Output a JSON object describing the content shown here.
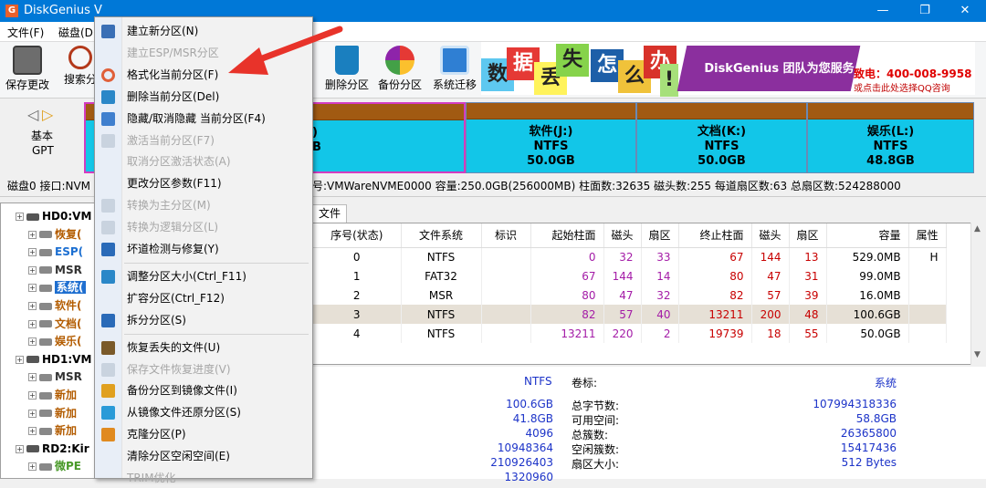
{
  "window": {
    "title": "DiskGenius V",
    "minimize": "—",
    "maximize": "❐",
    "close": "✕"
  },
  "menubar": [
    "文件(F)",
    "磁盘(D"
  ],
  "toolbar": {
    "buttons": [
      {
        "label": "保存更改",
        "icon": "save-icon"
      },
      {
        "label": "搜索分",
        "icon": "search-icon"
      },
      {
        "label": "删除分区",
        "icon": "delete-partition-icon"
      },
      {
        "label": "备份分区",
        "icon": "backup-partition-icon"
      },
      {
        "label": "系统迁移",
        "icon": "migrate-system-icon"
      }
    ]
  },
  "banner": {
    "tiles": [
      "数",
      "据",
      "丢",
      "失",
      "怎",
      "么",
      "办",
      "!"
    ],
    "slogan": "DiskGenius 团队为您服务",
    "phone": "致电：400-008-9958",
    "qq": "或点击此处选择QQ咨询"
  },
  "disk_nav": {
    "type": "基本",
    "scheme": "GPT"
  },
  "partitions": [
    {
      "name": ")",
      "fs": "",
      "size": "B"
    },
    {
      "name": "软件(J:)",
      "fs": "NTFS",
      "size": "50.0GB"
    },
    {
      "name": "文档(K:)",
      "fs": "NTFS",
      "size": "50.0GB"
    },
    {
      "name": "娱乐(L:)",
      "fs": "NTFS",
      "size": "48.8GB"
    }
  ],
  "disk_info": {
    "left": "磁盘0 接口:NVM",
    "right": "号:VMWareNVME0000  容量:250.0GB(256000MB)  柱面数:32635  磁头数:255  每道扇区数:63  总扇区数:524288000"
  },
  "tree": {
    "nodes": [
      {
        "label": "HD0:VM",
        "level": 0,
        "color": "#000000"
      },
      {
        "label": "恢复(",
        "level": 1,
        "color": "#b35c00"
      },
      {
        "label": "ESP(",
        "level": 1,
        "color": "#1c6fd1"
      },
      {
        "label": "MSR",
        "level": 1,
        "color": "#333333"
      },
      {
        "label": "系统(",
        "level": 1,
        "color": "#ffffff",
        "selected": true
      },
      {
        "label": "软件(",
        "level": 1,
        "color": "#b35c00"
      },
      {
        "label": "文档(",
        "level": 1,
        "color": "#b35c00"
      },
      {
        "label": "娱乐(",
        "level": 1,
        "color": "#b35c00"
      },
      {
        "label": "HD1:VM",
        "level": 0,
        "color": "#000000"
      },
      {
        "label": "MSR",
        "level": 1,
        "color": "#333333"
      },
      {
        "label": "新加",
        "level": 1,
        "color": "#b35c00"
      },
      {
        "label": "新加",
        "level": 1,
        "color": "#b35c00"
      },
      {
        "label": "新加",
        "level": 1,
        "color": "#b35c00"
      },
      {
        "label": "RD2:Kir",
        "level": 0,
        "color": "#000000"
      },
      {
        "label": "微PE",
        "level": 1,
        "color": "#4a9a2a"
      },
      {
        "label": "EFI(",
        "level": 1,
        "color": "#1c6fd1"
      }
    ]
  },
  "tabs": [
    "文件"
  ],
  "table": {
    "headers": [
      "序号(状态)",
      "文件系统",
      "标识",
      "起始柱面",
      "磁头",
      "扇区",
      "终止柱面",
      "磁头",
      "扇区",
      "容量",
      "属性"
    ],
    "rows": [
      [
        "0",
        "NTFS",
        "",
        "0",
        "32",
        "33",
        "67",
        "144",
        "13",
        "529.0MB",
        "H"
      ],
      [
        "1",
        "FAT32",
        "",
        "67",
        "144",
        "14",
        "80",
        "47",
        "31",
        "99.0MB",
        ""
      ],
      [
        "2",
        "MSR",
        "",
        "80",
        "47",
        "32",
        "82",
        "57",
        "39",
        "16.0MB",
        ""
      ],
      [
        "3",
        "NTFS",
        "",
        "82",
        "57",
        "40",
        "13211",
        "200",
        "48",
        "100.6GB",
        ""
      ],
      [
        "4",
        "NTFS",
        "",
        "13211",
        "220",
        "2",
        "19739",
        "18",
        "55",
        "50.0GB",
        ""
      ]
    ],
    "selected_row": 3
  },
  "details": {
    "fs": "NTFS",
    "volume_label_key": "卷标:",
    "volume_label_val": "系统",
    "left_values": [
      "100.6GB",
      "41.8GB",
      "4096",
      "10948364",
      "210926403",
      "1320960"
    ],
    "mid_keys": [
      "总字节数:",
      "可用空间:",
      "总簇数:",
      "空闲簇数:",
      "扇区大小:"
    ],
    "right_values": [
      "107994318336",
      "58.8GB",
      "26365800",
      "15417436",
      "512 Bytes"
    ]
  },
  "context_menu": {
    "items": [
      {
        "label": "建立新分区(N)",
        "enabled": true,
        "icon": "new-partition-icon"
      },
      {
        "label": "建立ESP/MSR分区",
        "enabled": false,
        "icon": ""
      },
      {
        "label": "格式化当前分区(F)",
        "enabled": true,
        "icon": "format-icon"
      },
      {
        "label": "删除当前分区(Del)",
        "enabled": true,
        "icon": "delete-icon"
      },
      {
        "label": "隐藏/取消隐藏 当前分区(F4)",
        "enabled": true,
        "icon": "hide-icon"
      },
      {
        "label": "激活当前分区(F7)",
        "enabled": false,
        "icon": "activate-icon"
      },
      {
        "label": "取消分区激活状态(A)",
        "enabled": false,
        "icon": ""
      },
      {
        "label": "更改分区参数(F11)",
        "enabled": true,
        "icon": ""
      },
      {
        "label": "转换为主分区(M)",
        "enabled": false,
        "icon": "convert-primary-icon"
      },
      {
        "label": "转换为逻辑分区(L)",
        "enabled": false,
        "icon": "convert-logical-icon"
      },
      {
        "label": "坏道检测与修复(Y)",
        "enabled": true,
        "icon": "bad-sector-icon"
      },
      {
        "label": "调整分区大小(Ctrl_F11)",
        "enabled": true,
        "icon": "resize-icon"
      },
      {
        "label": "扩容分区(Ctrl_F12)",
        "enabled": true,
        "icon": ""
      },
      {
        "label": "拆分分区(S)",
        "enabled": true,
        "icon": "split-icon"
      },
      {
        "label": "恢复丢失的文件(U)",
        "enabled": true,
        "icon": "recover-icon"
      },
      {
        "label": "保存文件恢复进度(V)",
        "enabled": false,
        "icon": "save-progress-icon"
      },
      {
        "label": "备份分区到镜像文件(I)",
        "enabled": true,
        "icon": "backup-image-icon"
      },
      {
        "label": "从镜像文件还原分区(S)",
        "enabled": true,
        "icon": "restore-image-icon"
      },
      {
        "label": "克隆分区(P)",
        "enabled": true,
        "icon": "clone-icon"
      },
      {
        "label": "清除分区空闲空间(E)",
        "enabled": true,
        "icon": ""
      },
      {
        "label": "TRIM优化",
        "enabled": false,
        "icon": ""
      }
    ]
  },
  "colors": {
    "titlebar": "#0078d7",
    "partition_fill": "#12c6e8",
    "partition_cap": "#a15a12",
    "arrow": "#e8332a"
  }
}
